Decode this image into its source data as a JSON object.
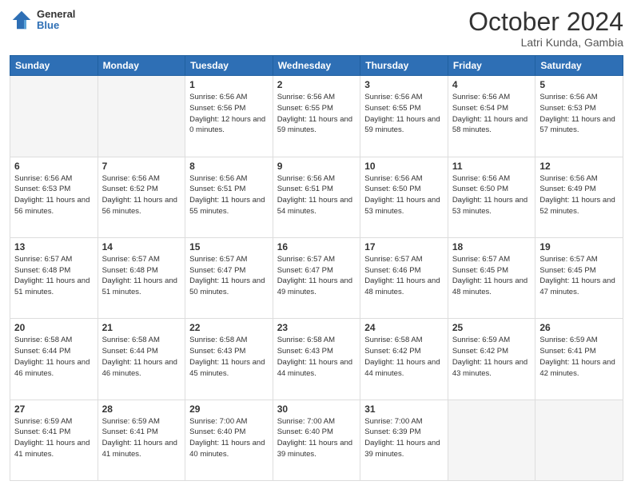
{
  "header": {
    "logo_general": "General",
    "logo_blue": "Blue",
    "month_title": "October 2024",
    "location": "Latri Kunda, Gambia"
  },
  "days_of_week": [
    "Sunday",
    "Monday",
    "Tuesday",
    "Wednesday",
    "Thursday",
    "Friday",
    "Saturday"
  ],
  "weeks": [
    [
      {
        "day": "",
        "empty": true
      },
      {
        "day": "",
        "empty": true
      },
      {
        "day": "1",
        "sunrise": "Sunrise: 6:56 AM",
        "sunset": "Sunset: 6:56 PM",
        "daylight": "Daylight: 12 hours and 0 minutes."
      },
      {
        "day": "2",
        "sunrise": "Sunrise: 6:56 AM",
        "sunset": "Sunset: 6:55 PM",
        "daylight": "Daylight: 11 hours and 59 minutes."
      },
      {
        "day": "3",
        "sunrise": "Sunrise: 6:56 AM",
        "sunset": "Sunset: 6:55 PM",
        "daylight": "Daylight: 11 hours and 59 minutes."
      },
      {
        "day": "4",
        "sunrise": "Sunrise: 6:56 AM",
        "sunset": "Sunset: 6:54 PM",
        "daylight": "Daylight: 11 hours and 58 minutes."
      },
      {
        "day": "5",
        "sunrise": "Sunrise: 6:56 AM",
        "sunset": "Sunset: 6:53 PM",
        "daylight": "Daylight: 11 hours and 57 minutes."
      }
    ],
    [
      {
        "day": "6",
        "sunrise": "Sunrise: 6:56 AM",
        "sunset": "Sunset: 6:53 PM",
        "daylight": "Daylight: 11 hours and 56 minutes."
      },
      {
        "day": "7",
        "sunrise": "Sunrise: 6:56 AM",
        "sunset": "Sunset: 6:52 PM",
        "daylight": "Daylight: 11 hours and 56 minutes."
      },
      {
        "day": "8",
        "sunrise": "Sunrise: 6:56 AM",
        "sunset": "Sunset: 6:51 PM",
        "daylight": "Daylight: 11 hours and 55 minutes."
      },
      {
        "day": "9",
        "sunrise": "Sunrise: 6:56 AM",
        "sunset": "Sunset: 6:51 PM",
        "daylight": "Daylight: 11 hours and 54 minutes."
      },
      {
        "day": "10",
        "sunrise": "Sunrise: 6:56 AM",
        "sunset": "Sunset: 6:50 PM",
        "daylight": "Daylight: 11 hours and 53 minutes."
      },
      {
        "day": "11",
        "sunrise": "Sunrise: 6:56 AM",
        "sunset": "Sunset: 6:50 PM",
        "daylight": "Daylight: 11 hours and 53 minutes."
      },
      {
        "day": "12",
        "sunrise": "Sunrise: 6:56 AM",
        "sunset": "Sunset: 6:49 PM",
        "daylight": "Daylight: 11 hours and 52 minutes."
      }
    ],
    [
      {
        "day": "13",
        "sunrise": "Sunrise: 6:57 AM",
        "sunset": "Sunset: 6:48 PM",
        "daylight": "Daylight: 11 hours and 51 minutes."
      },
      {
        "day": "14",
        "sunrise": "Sunrise: 6:57 AM",
        "sunset": "Sunset: 6:48 PM",
        "daylight": "Daylight: 11 hours and 51 minutes."
      },
      {
        "day": "15",
        "sunrise": "Sunrise: 6:57 AM",
        "sunset": "Sunset: 6:47 PM",
        "daylight": "Daylight: 11 hours and 50 minutes."
      },
      {
        "day": "16",
        "sunrise": "Sunrise: 6:57 AM",
        "sunset": "Sunset: 6:47 PM",
        "daylight": "Daylight: 11 hours and 49 minutes."
      },
      {
        "day": "17",
        "sunrise": "Sunrise: 6:57 AM",
        "sunset": "Sunset: 6:46 PM",
        "daylight": "Daylight: 11 hours and 48 minutes."
      },
      {
        "day": "18",
        "sunrise": "Sunrise: 6:57 AM",
        "sunset": "Sunset: 6:45 PM",
        "daylight": "Daylight: 11 hours and 48 minutes."
      },
      {
        "day": "19",
        "sunrise": "Sunrise: 6:57 AM",
        "sunset": "Sunset: 6:45 PM",
        "daylight": "Daylight: 11 hours and 47 minutes."
      }
    ],
    [
      {
        "day": "20",
        "sunrise": "Sunrise: 6:58 AM",
        "sunset": "Sunset: 6:44 PM",
        "daylight": "Daylight: 11 hours and 46 minutes."
      },
      {
        "day": "21",
        "sunrise": "Sunrise: 6:58 AM",
        "sunset": "Sunset: 6:44 PM",
        "daylight": "Daylight: 11 hours and 46 minutes."
      },
      {
        "day": "22",
        "sunrise": "Sunrise: 6:58 AM",
        "sunset": "Sunset: 6:43 PM",
        "daylight": "Daylight: 11 hours and 45 minutes."
      },
      {
        "day": "23",
        "sunrise": "Sunrise: 6:58 AM",
        "sunset": "Sunset: 6:43 PM",
        "daylight": "Daylight: 11 hours and 44 minutes."
      },
      {
        "day": "24",
        "sunrise": "Sunrise: 6:58 AM",
        "sunset": "Sunset: 6:42 PM",
        "daylight": "Daylight: 11 hours and 44 minutes."
      },
      {
        "day": "25",
        "sunrise": "Sunrise: 6:59 AM",
        "sunset": "Sunset: 6:42 PM",
        "daylight": "Daylight: 11 hours and 43 minutes."
      },
      {
        "day": "26",
        "sunrise": "Sunrise: 6:59 AM",
        "sunset": "Sunset: 6:41 PM",
        "daylight": "Daylight: 11 hours and 42 minutes."
      }
    ],
    [
      {
        "day": "27",
        "sunrise": "Sunrise: 6:59 AM",
        "sunset": "Sunset: 6:41 PM",
        "daylight": "Daylight: 11 hours and 41 minutes."
      },
      {
        "day": "28",
        "sunrise": "Sunrise: 6:59 AM",
        "sunset": "Sunset: 6:41 PM",
        "daylight": "Daylight: 11 hours and 41 minutes."
      },
      {
        "day": "29",
        "sunrise": "Sunrise: 7:00 AM",
        "sunset": "Sunset: 6:40 PM",
        "daylight": "Daylight: 11 hours and 40 minutes."
      },
      {
        "day": "30",
        "sunrise": "Sunrise: 7:00 AM",
        "sunset": "Sunset: 6:40 PM",
        "daylight": "Daylight: 11 hours and 39 minutes."
      },
      {
        "day": "31",
        "sunrise": "Sunrise: 7:00 AM",
        "sunset": "Sunset: 6:39 PM",
        "daylight": "Daylight: 11 hours and 39 minutes."
      },
      {
        "day": "",
        "empty": true
      },
      {
        "day": "",
        "empty": true
      }
    ]
  ]
}
